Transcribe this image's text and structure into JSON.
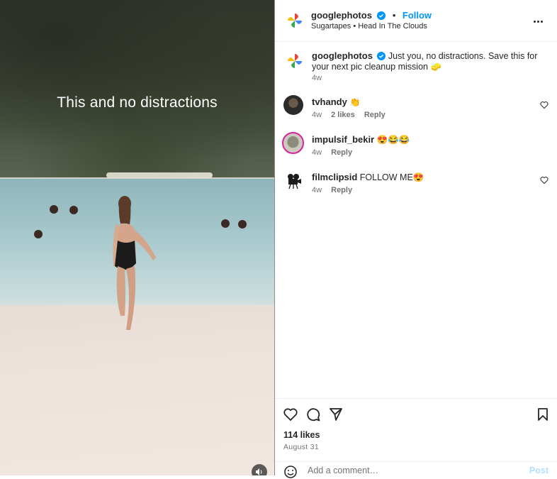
{
  "post": {
    "username": "googlephotos",
    "follow_label": "Follow",
    "audio": "Sugartapes • Head In The Clouds",
    "video_caption": "This and no distractions"
  },
  "caption": {
    "username": "googlephotos",
    "text": "Just you, no distractions. Save this for your next pic cleanup mission 🧽",
    "time": "4w"
  },
  "comments": [
    {
      "username": "tvhandy",
      "text": "👏",
      "time": "4w",
      "likes": "2 likes",
      "reply": "Reply"
    },
    {
      "username": "impulsif_bekir",
      "text": "😍😂😂",
      "time": "4w",
      "reply": "Reply"
    },
    {
      "username": "filmclipsid",
      "text": "FOLLOW ME😍",
      "time": "4w",
      "reply": "Reply"
    }
  ],
  "footer": {
    "likes": "114 likes",
    "date": "August 31",
    "comment_placeholder": "Add a comment…",
    "post_label": "Post"
  },
  "icons": [
    "heart-icon",
    "comment-icon",
    "share-icon",
    "bookmark-icon",
    "emoji-icon",
    "more-icon",
    "verified-icon",
    "sound-icon"
  ],
  "colors": {
    "accent": "#0095f6",
    "verified": "#0095f6",
    "text": "#262626",
    "muted": "#737373"
  }
}
